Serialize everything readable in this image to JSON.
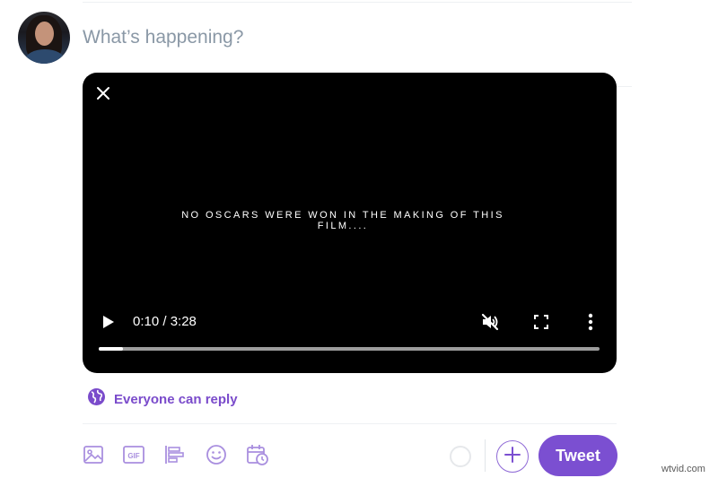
{
  "compose": {
    "placeholder": "What’s happening?",
    "avatar_icon": "user-avatar"
  },
  "video": {
    "caption": "NO OSCARS WERE WON IN THE MAKING OF THIS FILM....",
    "time": "0:10 / 3:28",
    "progress_fraction": 0.0481,
    "icons": [
      "close-icon",
      "play-icon",
      "muted-speaker-icon",
      "fullscreen-icon",
      "more-vertical-icon"
    ]
  },
  "reply": {
    "label": "Everyone can reply",
    "icon": "globe-icon"
  },
  "toolbar": {
    "icons": [
      "image-icon",
      "gif-icon",
      "poll-icon",
      "emoji-icon",
      "schedule-icon"
    ],
    "add_icon": "plus-icon",
    "tweet_label": "Tweet"
  },
  "colors": {
    "accent": "#7b4fd1",
    "accent_text": "#7a4bcb",
    "video_bg": "#000000"
  },
  "watermark": "wtvid.com"
}
